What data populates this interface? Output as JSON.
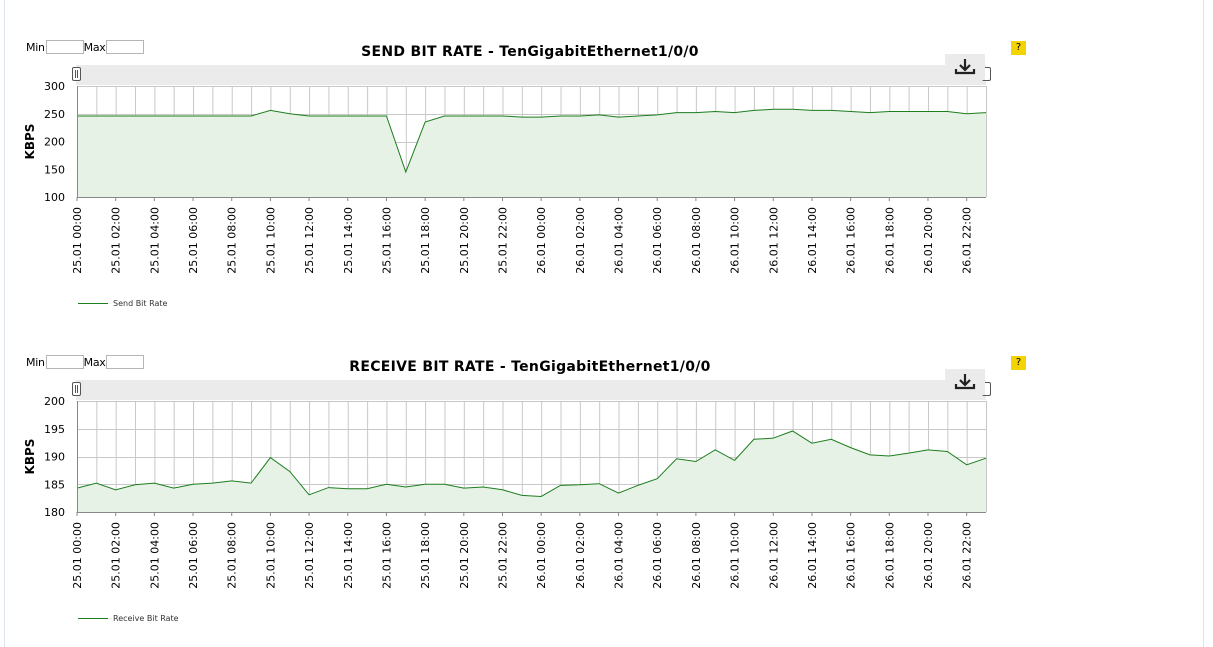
{
  "controls": {
    "min_label": "Min",
    "max_label": "Max",
    "help_label": "?"
  },
  "colors": {
    "line": "#1e7d1e",
    "fill": "#e5f2e5",
    "grid": "#c8c8c8",
    "help": "#f3d400"
  },
  "icons": {
    "download": "download-icon"
  },
  "chart_data": [
    {
      "type": "area",
      "title": "SEND BIT RATE - TenGigabitEthernet1/0/0",
      "xlabel": "",
      "ylabel": "KBPS",
      "ylim": [
        100,
        300
      ],
      "yticks": [
        100,
        150,
        200,
        250,
        300
      ],
      "grid": true,
      "legend_position": "bottom-left",
      "x_tick_labels": [
        "25.01 00:00",
        "25.01 02:00",
        "25.01 04:00",
        "25.01 06:00",
        "25.01 08:00",
        "25.01 10:00",
        "25.01 12:00",
        "25.01 14:00",
        "25.01 16:00",
        "25.01 18:00",
        "25.01 20:00",
        "25.01 22:00",
        "26.01 00:00",
        "26.01 02:00",
        "26.01 04:00",
        "26.01 06:00",
        "26.01 08:00",
        "26.01 10:00",
        "26.01 12:00",
        "26.01 14:00",
        "26.01 16:00",
        "26.01 18:00",
        "26.01 20:00",
        "26.01 22:00"
      ],
      "series": [
        {
          "name": "Send Bit Rate",
          "x": [
            "25.01 00:00",
            "25.01 01:00",
            "25.01 02:00",
            "25.01 03:00",
            "25.01 04:00",
            "25.01 05:00",
            "25.01 06:00",
            "25.01 07:00",
            "25.01 08:00",
            "25.01 09:00",
            "25.01 10:00",
            "25.01 11:00",
            "25.01 12:00",
            "25.01 13:00",
            "25.01 14:00",
            "25.01 15:00",
            "25.01 16:00",
            "25.01 17:00",
            "25.01 18:00",
            "25.01 19:00",
            "25.01 20:00",
            "25.01 21:00",
            "25.01 22:00",
            "25.01 23:00",
            "26.01 00:00",
            "26.01 01:00",
            "26.01 02:00",
            "26.01 03:00",
            "26.01 04:00",
            "26.01 05:00",
            "26.01 06:00",
            "26.01 07:00",
            "26.01 08:00",
            "26.01 09:00",
            "26.01 10:00",
            "26.01 11:00",
            "26.01 12:00",
            "26.01 13:00",
            "26.01 14:00",
            "26.01 15:00",
            "26.01 16:00",
            "26.01 17:00",
            "26.01 18:00",
            "26.01 19:00",
            "26.01 20:00",
            "26.01 21:00",
            "26.01 22:00",
            "26.01 23:00"
          ],
          "values": [
            246,
            246,
            246,
            246,
            246,
            246,
            246,
            246,
            246,
            246,
            256,
            250,
            246,
            246,
            246,
            246,
            246,
            145,
            235,
            246,
            246,
            246,
            246,
            244,
            244,
            246,
            246,
            248,
            244,
            246,
            248,
            252,
            252,
            254,
            252,
            256,
            258,
            258,
            256,
            256,
            254,
            252,
            254,
            254,
            254,
            254,
            250,
            252
          ]
        }
      ]
    },
    {
      "type": "area",
      "title": "RECEIVE BIT RATE - TenGigabitEthernet1/0/0",
      "xlabel": "",
      "ylabel": "KBPS",
      "ylim": [
        180,
        200
      ],
      "yticks": [
        180,
        185,
        190,
        195,
        200
      ],
      "grid": true,
      "legend_position": "bottom-left",
      "x_tick_labels": [
        "25.01 00:00",
        "25.01 02:00",
        "25.01 04:00",
        "25.01 06:00",
        "25.01 08:00",
        "25.01 10:00",
        "25.01 12:00",
        "25.01 14:00",
        "25.01 16:00",
        "25.01 18:00",
        "25.01 20:00",
        "25.01 22:00",
        "26.01 00:00",
        "26.01 02:00",
        "26.01 04:00",
        "26.01 06:00",
        "26.01 08:00",
        "26.01 10:00",
        "26.01 12:00",
        "26.01 14:00",
        "26.01 16:00",
        "26.01 18:00",
        "26.01 20:00",
        "26.01 22:00"
      ],
      "series": [
        {
          "name": "Receive Bit Rate",
          "x": [
            "25.01 00:00",
            "25.01 01:00",
            "25.01 02:00",
            "25.01 03:00",
            "25.01 04:00",
            "25.01 05:00",
            "25.01 06:00",
            "25.01 07:00",
            "25.01 08:00",
            "25.01 09:00",
            "25.01 10:00",
            "25.01 11:00",
            "25.01 12:00",
            "25.01 13:00",
            "25.01 14:00",
            "25.01 15:00",
            "25.01 16:00",
            "25.01 17:00",
            "25.01 18:00",
            "25.01 19:00",
            "25.01 20:00",
            "25.01 21:00",
            "25.01 22:00",
            "25.01 23:00",
            "26.01 00:00",
            "26.01 01:00",
            "26.01 02:00",
            "26.01 03:00",
            "26.01 04:00",
            "26.01 05:00",
            "26.01 06:00",
            "26.01 07:00",
            "26.01 08:00",
            "26.01 09:00",
            "26.01 10:00",
            "26.01 11:00",
            "26.01 12:00",
            "26.01 13:00",
            "26.01 14:00",
            "26.01 15:00",
            "26.01 16:00",
            "26.01 17:00",
            "26.01 18:00",
            "26.01 19:00",
            "26.01 20:00",
            "26.01 21:00",
            "26.01 22:00",
            "26.01 23:00"
          ],
          "values": [
            184.3,
            185.2,
            184.0,
            184.9,
            185.2,
            184.3,
            185.0,
            185.2,
            185.6,
            185.2,
            189.8,
            187.3,
            183.1,
            184.4,
            184.2,
            184.2,
            185.0,
            184.5,
            185.0,
            185.0,
            184.3,
            184.5,
            184.0,
            183.0,
            182.8,
            184.8,
            184.9,
            185.1,
            183.4,
            184.8,
            186.0,
            189.6,
            189.1,
            191.2,
            189.3,
            193.1,
            193.3,
            194.6,
            192.4,
            193.1,
            191.6,
            190.3,
            190.1,
            190.6,
            191.2,
            190.9,
            188.5,
            189.7
          ]
        }
      ]
    }
  ]
}
